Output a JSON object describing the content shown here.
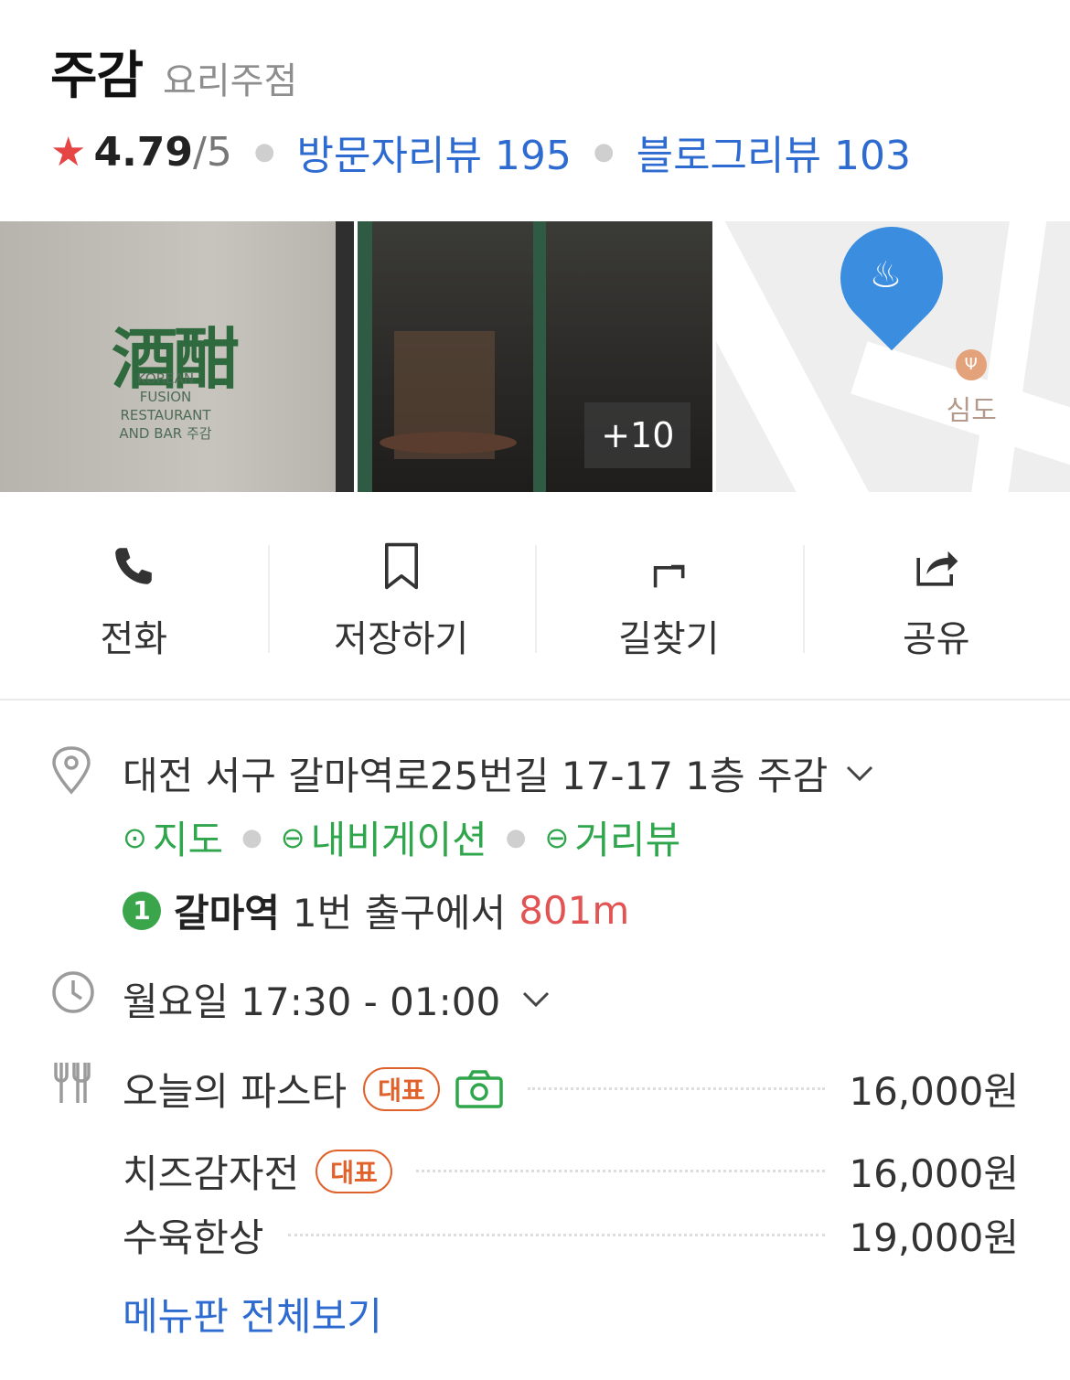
{
  "place": {
    "name": "주감",
    "category": "요리주점",
    "rating": "4.79",
    "rating_max": "/5",
    "visitor_reviews": "방문자리뷰 195",
    "blog_reviews": "블로그리뷰 103"
  },
  "photos": {
    "photo1_logo": "酒酣",
    "photo1_tag": "KOREAN FUSION RESTAURANT AND BAR 주감",
    "more_count": "+10",
    "map_poi_label": "심도"
  },
  "actions": {
    "call": "전화",
    "save": "저장하기",
    "directions": "길찾기",
    "share": "공유"
  },
  "address": {
    "text": "대전 서구 갈마역로25번길 17-17 1층 주감",
    "link_map": "지도",
    "link_navigation": "내비게이션",
    "link_street_view": "거리뷰",
    "subway_line": "1",
    "subway_station": "갈마역",
    "subway_exit": "1번 출구에서",
    "subway_distance": "801m"
  },
  "hours": {
    "text": "월요일 17:30 - 01:00"
  },
  "menu": {
    "items": [
      {
        "name": "오늘의 파스타",
        "badge": "대표",
        "price": "16,000원"
      },
      {
        "name": "치즈감자전",
        "badge": "대표",
        "price": "16,000원"
      },
      {
        "name": "수육한상",
        "price": "19,000원"
      }
    ],
    "view_all": "메뉴판 전체보기"
  },
  "colors": {
    "link_blue": "#2e6bd1",
    "green": "#2fa54c",
    "star_red": "#e64545",
    "badge_orange": "#e0612a",
    "distance_red": "#e25454"
  }
}
